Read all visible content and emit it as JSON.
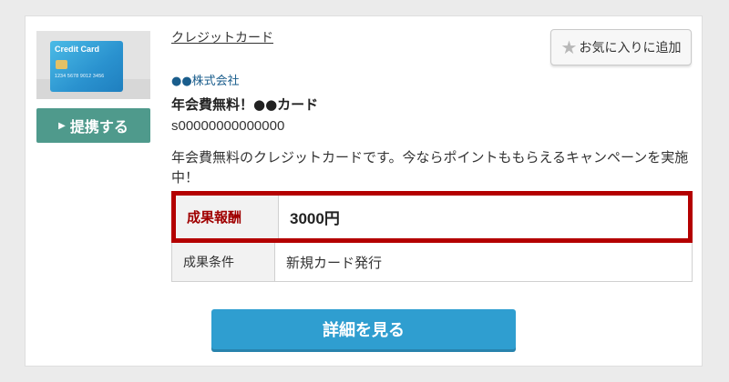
{
  "offer": {
    "thumbnail": {
      "card_brand": "Credit Card",
      "card_number": "1234 5678 9012 3456",
      "icon": "credit-card-icon"
    },
    "offer_button_label": "提携する",
    "category": "クレジットカード",
    "favorite_button_label": "お気に入りに追加",
    "company": "●●株式会社",
    "title": "年会費無料！●●カード",
    "code": "s00000000000000",
    "description": "年会費無料のクレジットカードです。今ならポイントももらえるキャンペーンを実施中！",
    "table": {
      "reward_label": "成果報酬",
      "reward_value": "3000円",
      "condition_label": "成果条件",
      "condition_value": "新規カード発行"
    },
    "details_button_label": "詳細を見る"
  },
  "colors": {
    "accent_teal": "#4f9a8c",
    "accent_blue": "#2f9ed0",
    "highlight_red": "#b40000",
    "company_link": "#1a5d8c"
  }
}
